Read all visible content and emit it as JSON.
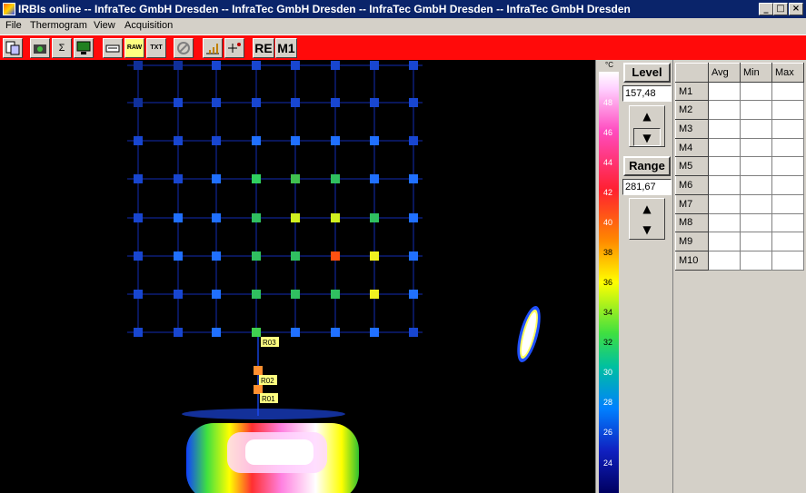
{
  "window": {
    "title": "IRBIs online -- InfraTec GmbH Dresden -- InfraTec GmbH Dresden -- InfraTec GmbH Dresden -- InfraTec GmbH Dresden",
    "minimize": "_",
    "maximize": "□",
    "close": "×"
  },
  "menu": [
    "File",
    "Thermogram",
    "View",
    "Acquisition"
  ],
  "toolbar": {
    "re_label": "RE",
    "m1_label": "M1",
    "raw_label": "RAW",
    "txt_label": "TXT",
    "sum_label": "Σ"
  },
  "colors": {
    "toolbar_bg": "#ff0a0a",
    "titlebar_bg": "#0a246a",
    "panel_bg": "#d4d0c8"
  },
  "colorbar": {
    "unit": "°C",
    "ticks": [
      "48",
      "46",
      "44",
      "42",
      "40",
      "38",
      "36",
      "34",
      "32",
      "30",
      "28",
      "26",
      "24"
    ]
  },
  "level": {
    "label": "Level",
    "value": "157,48"
  },
  "range": {
    "label": "Range",
    "value": "281,67"
  },
  "spinner": {
    "up": "▲",
    "down": "▼"
  },
  "table": {
    "headers": [
      "",
      "Avg",
      "Min",
      "Max"
    ],
    "rows": [
      "M1",
      "M2",
      "M3",
      "M4",
      "M5",
      "M6",
      "M7",
      "M8",
      "M9",
      "M10"
    ]
  },
  "thermogram": {
    "markers": [
      "R03",
      "R02",
      "R01"
    ]
  }
}
